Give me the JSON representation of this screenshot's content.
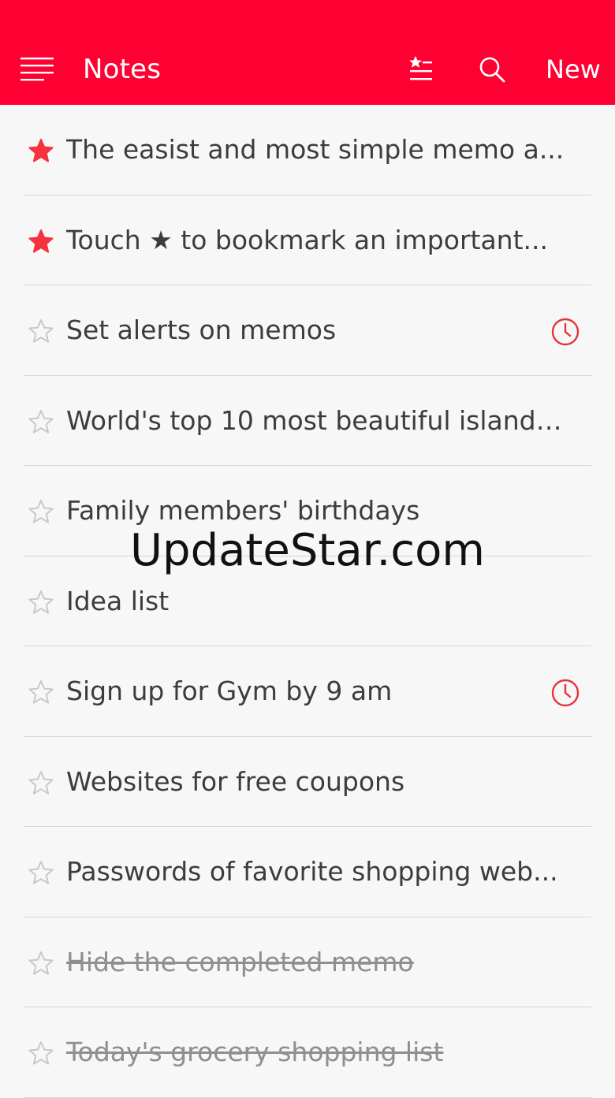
{
  "header": {
    "title": "Notes",
    "new_label": "New",
    "icons": [
      "menu-icon",
      "star-list-icon",
      "search-icon"
    ],
    "background": "#ff0032"
  },
  "notes": [
    {
      "title": "The easist and most simple memo a...",
      "starred": true,
      "alarm": false,
      "completed": false
    },
    {
      "title": "Touch ★ to bookmark an important...",
      "starred": true,
      "alarm": false,
      "completed": false
    },
    {
      "title": "Set alerts on memos",
      "starred": false,
      "alarm": true,
      "completed": false
    },
    {
      "title": "World's top 10 most beautiful islands...",
      "starred": false,
      "alarm": false,
      "completed": false
    },
    {
      "title": "Family members' birthdays",
      "starred": false,
      "alarm": false,
      "completed": false
    },
    {
      "title": "Idea list",
      "starred": false,
      "alarm": false,
      "completed": false
    },
    {
      "title": "Sign up for Gym by 9 am",
      "starred": false,
      "alarm": true,
      "completed": false
    },
    {
      "title": "Websites for free coupons",
      "starred": false,
      "alarm": false,
      "completed": false
    },
    {
      "title": "Passwords of favorite shopping web...",
      "starred": false,
      "alarm": false,
      "completed": false
    },
    {
      "title": "Hide the completed memo",
      "starred": false,
      "alarm": false,
      "completed": true
    },
    {
      "title": "Today's grocery shopping list",
      "starred": false,
      "alarm": false,
      "completed": true
    }
  ],
  "watermark": "UpdateStar.com",
  "colors": {
    "accent": "#ff0032",
    "star_filled": "#f5333f",
    "star_empty": "#c8c8c8",
    "alarm": "#e8313a"
  }
}
